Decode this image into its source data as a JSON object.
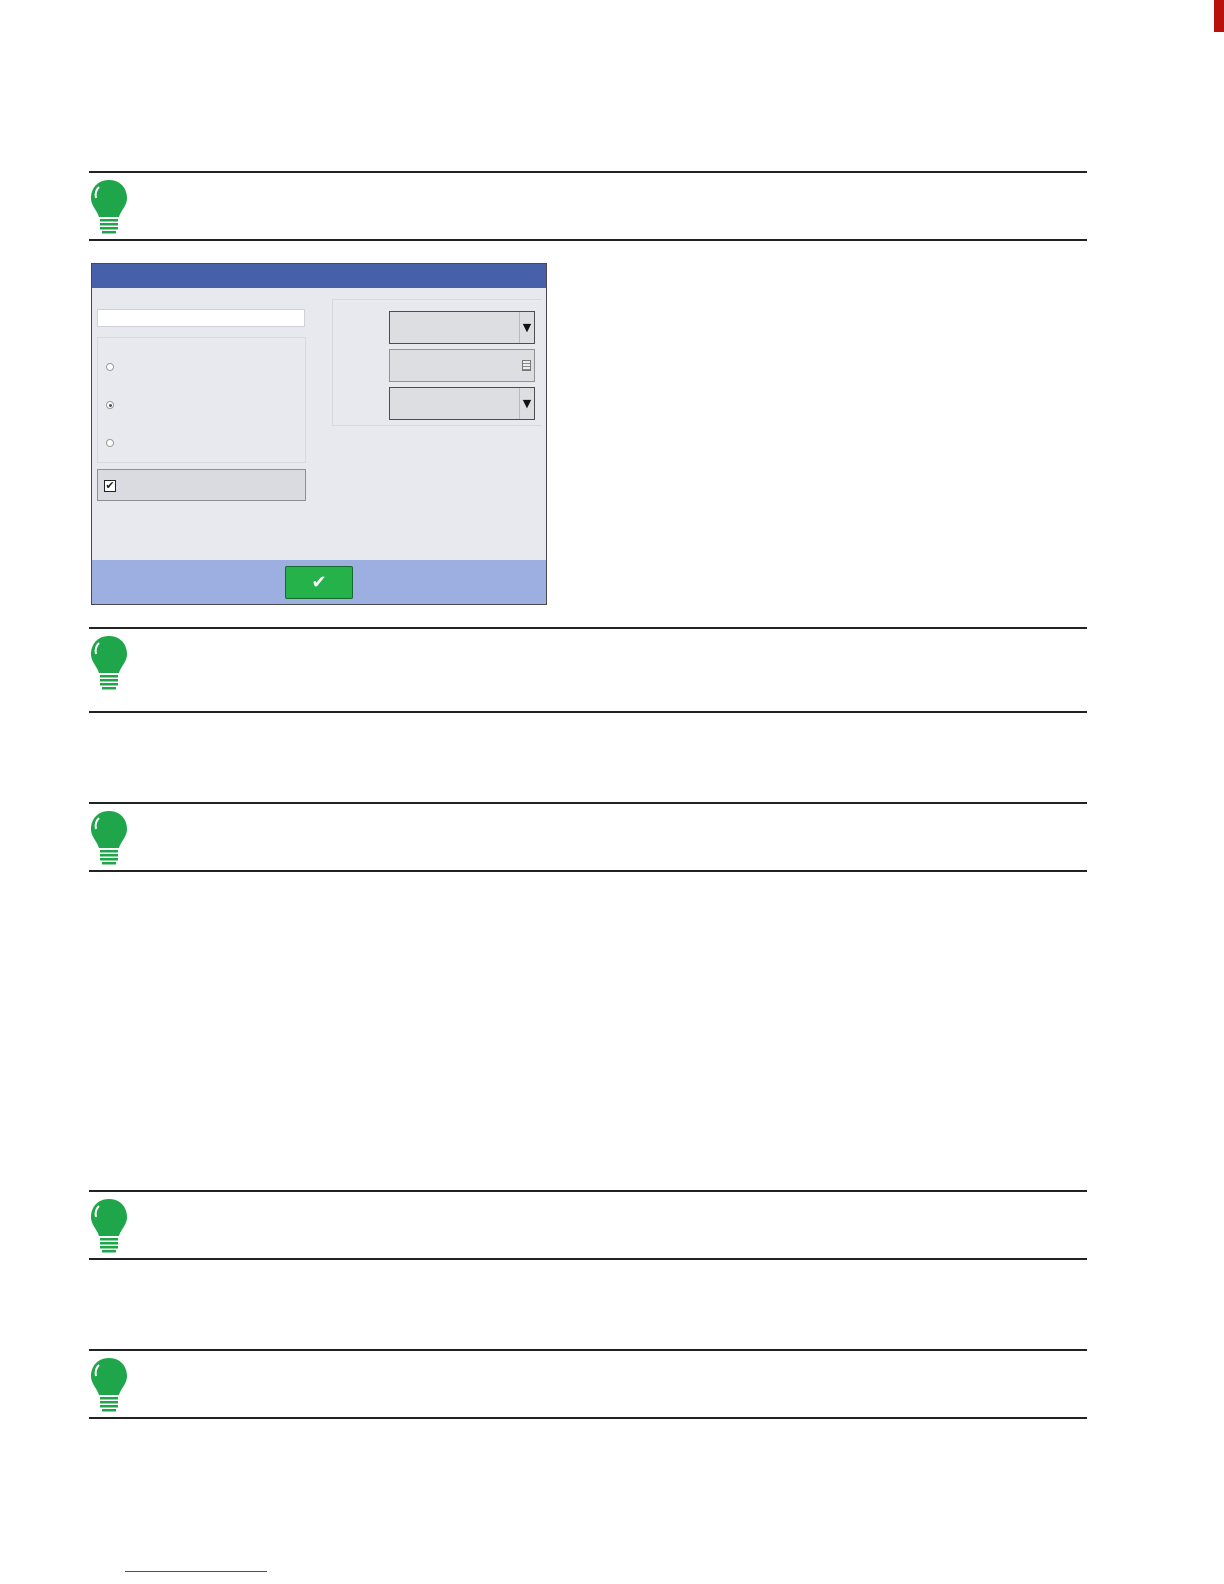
{
  "page": {
    "notes": [
      {
        "text": ""
      },
      {
        "text": ""
      },
      {
        "text": ""
      },
      {
        "text": ""
      },
      {
        "text": ""
      }
    ],
    "footer_link": ""
  },
  "dialog": {
    "title": "",
    "name_input": {
      "value": "",
      "placeholder": ""
    },
    "radio_options": [
      {
        "label": "",
        "checked": false
      },
      {
        "label": "",
        "checked": true
      },
      {
        "label": "",
        "checked": false
      }
    ],
    "checkbox": {
      "label": "",
      "checked": true,
      "mark": "✔"
    },
    "right_fields": [
      {
        "label": "",
        "value": "",
        "control": "dropdown"
      },
      {
        "label": "",
        "value": "",
        "control": "keyboard"
      },
      {
        "label": "",
        "value": "",
        "control": "dropdown"
      }
    ],
    "dropdown_glyph": "▼",
    "ok_glyph": "✔"
  },
  "colors": {
    "bulb": "#1fa64a",
    "titlebar": "#4661a9",
    "footer": "#9daee1",
    "ok_button": "#26b24a",
    "page_marker": "#b9100c"
  },
  "icons": {
    "note": "lightbulb-icon",
    "ok": "checkmark-icon",
    "dropdown": "chevron-down-icon",
    "keyboard": "keyboard-icon"
  }
}
